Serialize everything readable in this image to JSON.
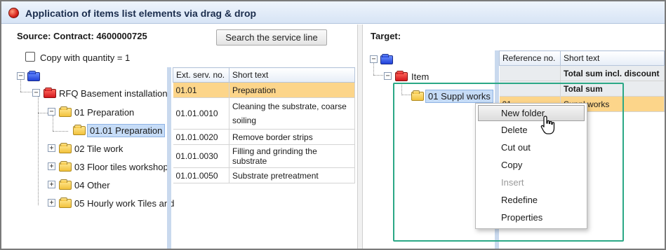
{
  "window": {
    "title": "Application of items list elements via drag & drop"
  },
  "source": {
    "label": "Source: Contract: 4600000725",
    "search_button": "Search the service line",
    "copy_checkbox": {
      "label": "Copy with quantity = 1",
      "checked": false
    },
    "tree": {
      "root": {
        "label": "RFQ Basement installation"
      },
      "items": [
        {
          "label": "01 Preparation",
          "expanded": true
        },
        {
          "label": "01.01 Preparation",
          "selected": true
        },
        {
          "label": "02 Tile work",
          "expanded": false
        },
        {
          "label": "03 Floor tiles workshop",
          "expanded": false
        },
        {
          "label": "04 Other",
          "expanded": false
        },
        {
          "label": "05 Hourly work Tiles and",
          "expanded": false
        }
      ]
    },
    "grid": {
      "columns": [
        "Ext. serv. no.",
        "Short text"
      ],
      "rows": [
        {
          "no": "01.01",
          "text": "Preparation",
          "highlight": true
        },
        {
          "no": "01.01.0010",
          "text": "Cleaning the substrate, coarse soiling"
        },
        {
          "no": "01.01.0020",
          "text": "Remove border strips"
        },
        {
          "no": "01.01.0030",
          "text": "Filling and grinding the substrate"
        },
        {
          "no": "01.01.0050",
          "text": "Substrate pretreatment"
        }
      ]
    }
  },
  "target": {
    "label": "Target:",
    "tree": {
      "item": {
        "label": "Item"
      },
      "folder": {
        "label": "01 Suppl works",
        "selected": true
      }
    },
    "grid": {
      "columns": [
        "Reference no.",
        "Short text"
      ],
      "rows": [
        {
          "ref": "",
          "text": "Total sum incl. discount",
          "style": "grey"
        },
        {
          "ref": "",
          "text": "Total sum",
          "style": "grey"
        },
        {
          "ref": "01",
          "text": "Suppl works",
          "style": "highlight"
        }
      ]
    }
  },
  "context_menu": {
    "items": [
      {
        "label": "New folder",
        "active": true
      },
      {
        "label": "Delete"
      },
      {
        "label": "Cut out"
      },
      {
        "label": "Copy"
      },
      {
        "label": "Insert",
        "disabled": true
      },
      {
        "label": "Redefine"
      },
      {
        "label": "Properties"
      }
    ]
  },
  "colors": {
    "accent_highlight": "#fcd58a",
    "selection_box": "#2ba886",
    "folder_yellow": "#f2c23c",
    "folder_red": "#d3171d",
    "folder_blue": "#2040d8"
  },
  "icons": [
    "app-icon",
    "folder-icon",
    "plus-minus-toggle",
    "hand-cursor-icon"
  ]
}
